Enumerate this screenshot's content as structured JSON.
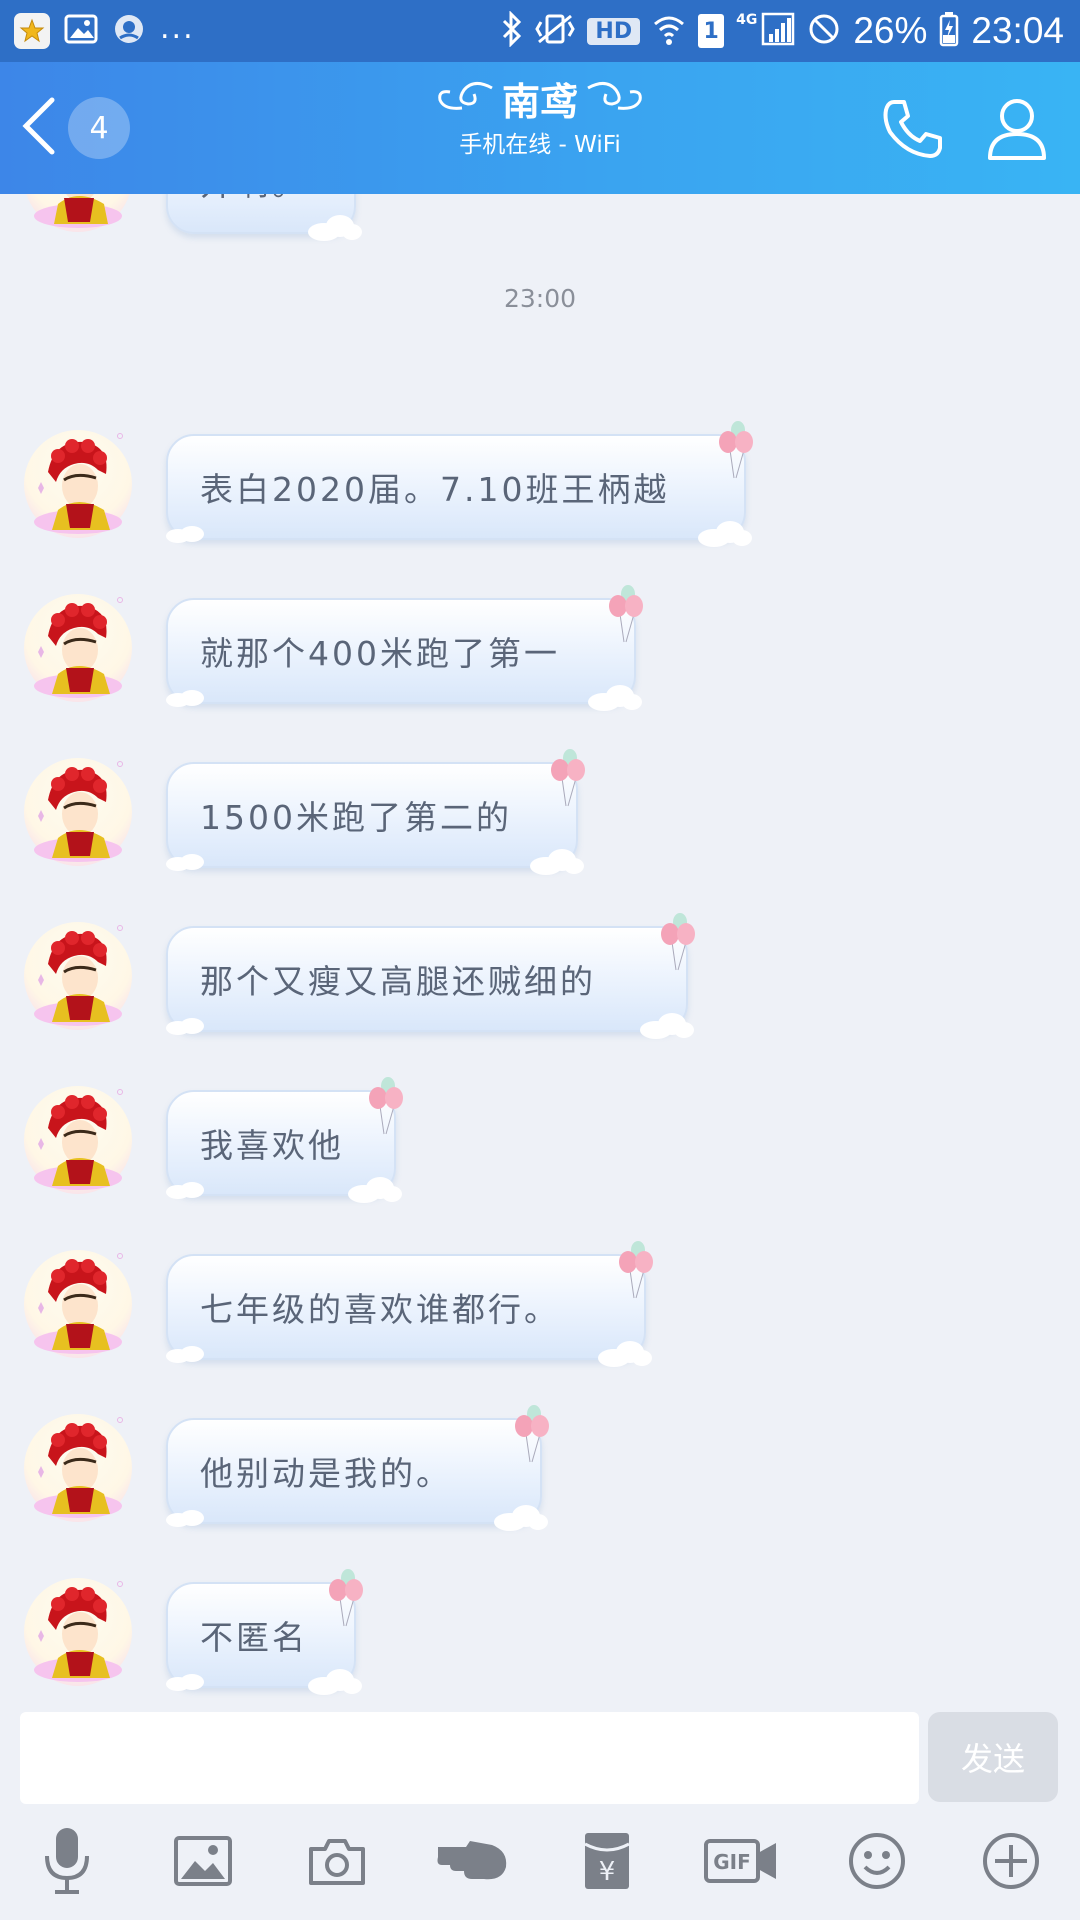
{
  "status_bar": {
    "hd": "HD",
    "sim": "1",
    "network": "4G",
    "battery": "26%",
    "time": "23:04",
    "more": "..."
  },
  "header": {
    "unread_count": "4",
    "contact_name": "南鸢",
    "contact_status": "手机在线 - WiFi"
  },
  "chat": {
    "top_partial_text": "开啊。",
    "timestamp": "23:00",
    "messages": [
      {
        "text": "表白2020届。7.10班王柄越"
      },
      {
        "text": "就那个400米跑了第一"
      },
      {
        "text": "1500米跑了第二的"
      },
      {
        "text": "那个又瘦又高腿还贼细的"
      },
      {
        "text": "我喜欢他"
      },
      {
        "text": "七年级的喜欢谁都行。"
      },
      {
        "text": "他别动是我的。"
      },
      {
        "text": "不匿名"
      }
    ]
  },
  "input": {
    "value": "",
    "send_label": "发送"
  },
  "toolbar": {
    "items": [
      "microphone-icon",
      "image-icon",
      "camera-icon",
      "poke-icon",
      "red-packet-icon",
      "gif-icon",
      "emoji-icon",
      "plus-icon"
    ]
  },
  "colors": {
    "status_bar": "#2e6fc6",
    "header_start": "#3d86e8",
    "header_end": "#39b4f4",
    "background": "#eef1f7",
    "bubble_text": "#5a6578"
  }
}
